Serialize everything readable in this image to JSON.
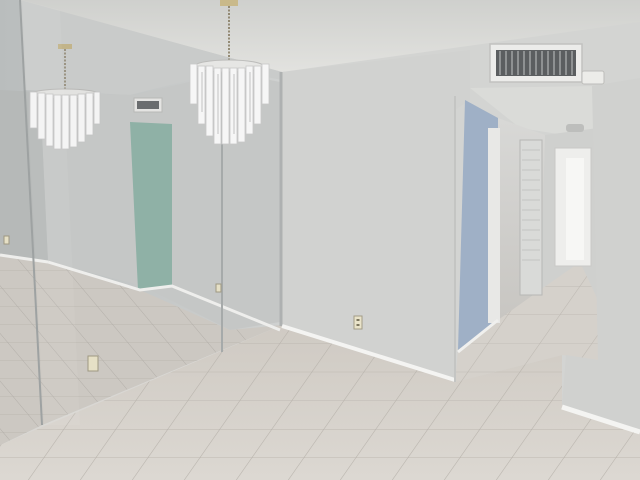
{
  "scene": {
    "colors": {
      "ceiling": "#dcdcd8",
      "wall": "#d2d3d1",
      "wall_shadow": "#bcbdbc",
      "floor": "#d7d3cd",
      "grout": "#b9b5ae",
      "baseboard": "#f2f2f0",
      "mirror_tint": "#c6c8c7",
      "hall_wall_blue": "#9fb0c6",
      "door_green": "#8fb1a6",
      "light_crystal": "#f4f4f4"
    },
    "icons": [
      "chandelier-icon",
      "air-vent-icon",
      "electrical-outlet-icon",
      "thermostat-icon"
    ]
  }
}
